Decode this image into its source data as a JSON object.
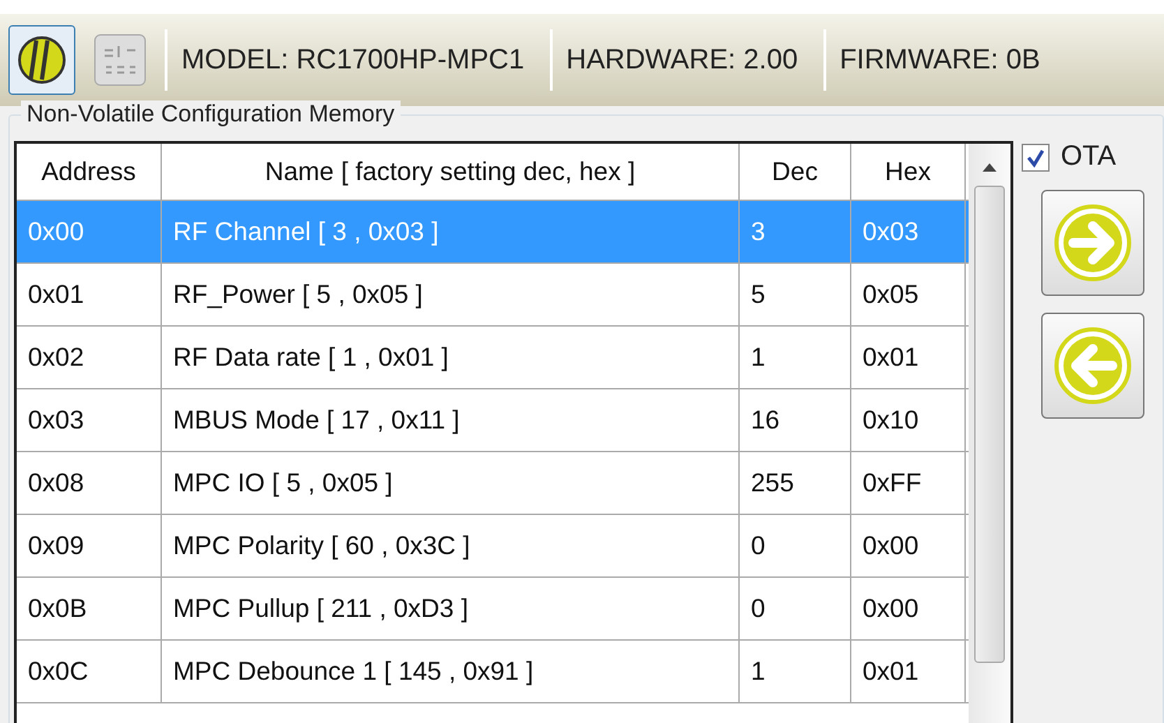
{
  "toolbar": {
    "items": [
      {
        "kind": "connect",
        "selected": true
      },
      {
        "kind": "text-mode",
        "selected": false
      }
    ],
    "fields": [
      "MODEL:  RC1700HP-MPC1",
      "HARDWARE:  2.00",
      "FIRMWARE: 0B"
    ]
  },
  "group": {
    "title": "Non-Volatile Configuration Memory"
  },
  "table": {
    "columns": [
      "Address",
      "Name  [ factory setting dec, hex ]",
      "Dec",
      "Hex"
    ],
    "rows": [
      {
        "address": "0x00",
        "name": "RF Channel [ 3 , 0x03 ]",
        "dec": "3",
        "hex": "0x03",
        "selected": true
      },
      {
        "address": "0x01",
        "name": "RF_Power [ 5 , 0x05 ]",
        "dec": "5",
        "hex": "0x05",
        "selected": false
      },
      {
        "address": "0x02",
        "name": "RF Data rate [ 1 , 0x01 ]",
        "dec": "1",
        "hex": "0x01",
        "selected": false
      },
      {
        "address": "0x03",
        "name": "MBUS Mode [ 17 , 0x11 ]",
        "dec": "16",
        "hex": "0x10",
        "selected": false
      },
      {
        "address": "0x08",
        "name": "MPC IO [ 5 , 0x05 ]",
        "dec": "255",
        "hex": "0xFF",
        "selected": false
      },
      {
        "address": "0x09",
        "name": "MPC Polarity [ 60 , 0x3C ]",
        "dec": "0",
        "hex": "0x00",
        "selected": false
      },
      {
        "address": "0x0B",
        "name": "MPC Pullup [ 211 , 0xD3 ]",
        "dec": "0",
        "hex": "0x00",
        "selected": false
      },
      {
        "address": "0x0C",
        "name": "MPC Debounce 1 [ 145 , 0x91 ]",
        "dec": "1",
        "hex": "0x01",
        "selected": false
      }
    ]
  },
  "ota": {
    "label": "OTA",
    "checked": true
  }
}
